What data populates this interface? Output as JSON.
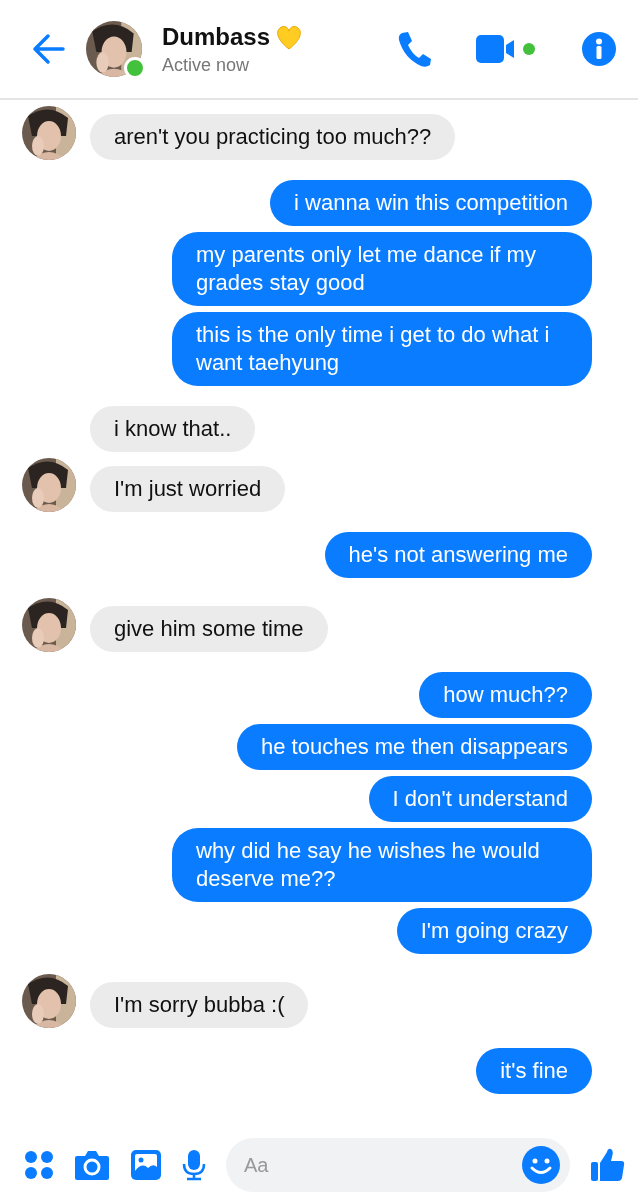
{
  "header": {
    "title": "Dumbass",
    "status": "Active now",
    "online": true
  },
  "messages": [
    {
      "kind": "received",
      "text": "aren't you practicing too much??",
      "avatar": true
    },
    {
      "kind": "sent",
      "text": "i wanna win this competition"
    },
    {
      "kind": "sent",
      "text": "my parents only let me dance if my grades stay good"
    },
    {
      "kind": "sent",
      "text": "this is the only time i get to do what i want taehyung"
    },
    {
      "kind": "received",
      "text": "i know that..",
      "avatar": false
    },
    {
      "kind": "received",
      "text": "I'm just worried",
      "avatar": true
    },
    {
      "kind": "sent",
      "text": "he's not answering me"
    },
    {
      "kind": "received",
      "text": "give him some time",
      "avatar": true
    },
    {
      "kind": "sent",
      "text": "how much??"
    },
    {
      "kind": "sent",
      "text": "he touches me then disappears"
    },
    {
      "kind": "sent",
      "text": "I don't understand"
    },
    {
      "kind": "sent",
      "text": "why did he say he wishes he would deserve me??"
    },
    {
      "kind": "sent",
      "text": "I'm going crazy"
    },
    {
      "kind": "received",
      "text": "I'm sorry bubba :(",
      "avatar": true
    },
    {
      "kind": "sent",
      "text": "it's fine"
    }
  ],
  "composer": {
    "placeholder": "Aa"
  }
}
